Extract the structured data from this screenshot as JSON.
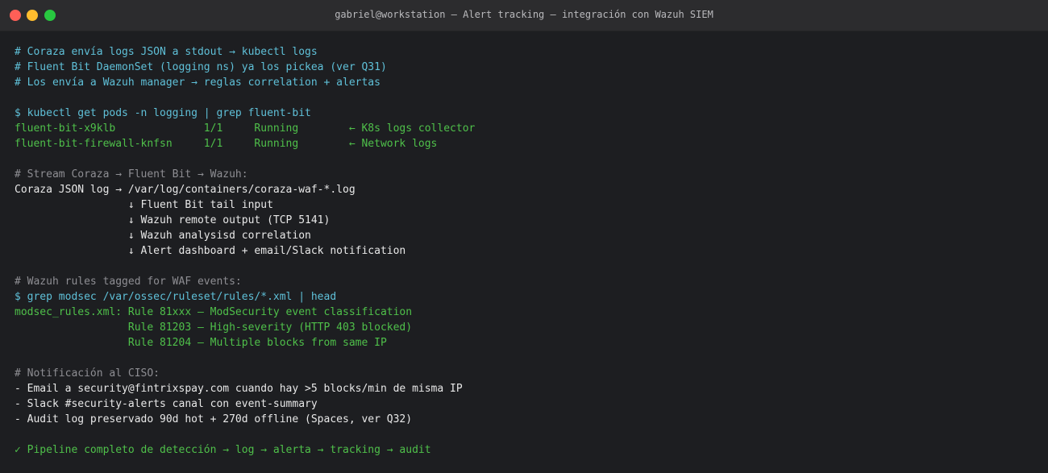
{
  "window": {
    "title": "gabriel@workstation — Alert tracking — integración con Wazuh SIEM"
  },
  "terminal": {
    "lines": [
      {
        "text": "# Coraza envía logs JSON a stdout → kubectl logs",
        "style": "c-comment-cyan"
      },
      {
        "text": "# Fluent Bit DaemonSet (logging ns) ya los pickea (ver Q31)",
        "style": "c-comment-cyan"
      },
      {
        "text": "# Los envía a Wazuh manager → reglas correlation + alertas",
        "style": "c-comment-cyan"
      },
      {
        "text": "",
        "style": "c-white"
      },
      {
        "text": "$ kubectl get pods -n logging | grep fluent-bit",
        "style": "c-cmd"
      },
      {
        "text": "fluent-bit-x9klb              1/1     Running        ← K8s logs collector",
        "style": "c-green"
      },
      {
        "text": "fluent-bit-firewall-knfsn     1/1     Running        ← Network logs",
        "style": "c-green"
      },
      {
        "text": "",
        "style": "c-white"
      },
      {
        "text": "# Stream Coraza → Fluent Bit → Wazuh:",
        "style": "c-gray"
      },
      {
        "text": "Coraza JSON log → /var/log/containers/coraza-waf-*.log",
        "style": "c-white"
      },
      {
        "text": "                  ↓ Fluent Bit tail input",
        "style": "c-white"
      },
      {
        "text": "                  ↓ Wazuh remote output (TCP 5141)",
        "style": "c-white"
      },
      {
        "text": "                  ↓ Wazuh analysisd correlation",
        "style": "c-white"
      },
      {
        "text": "                  ↓ Alert dashboard + email/Slack notification",
        "style": "c-white"
      },
      {
        "text": "",
        "style": "c-white"
      },
      {
        "text": "# Wazuh rules tagged for WAF events:",
        "style": "c-gray"
      },
      {
        "text": "$ grep modsec /var/ossec/ruleset/rules/*.xml | head",
        "style": "c-cmd"
      },
      {
        "text": "modsec_rules.xml: Rule 81xxx — ModSecurity event classification",
        "style": "c-green"
      },
      {
        "text": "                  Rule 81203 — High-severity (HTTP 403 blocked)",
        "style": "c-green"
      },
      {
        "text": "                  Rule 81204 — Multiple blocks from same IP",
        "style": "c-green"
      },
      {
        "text": "",
        "style": "c-white"
      },
      {
        "text": "# Notificación al CISO:",
        "style": "c-gray"
      },
      {
        "text": "- Email a security@fintrixspay.com cuando hay >5 blocks/min de misma IP",
        "style": "c-white"
      },
      {
        "text": "- Slack #security-alerts canal con event-summary",
        "style": "c-white"
      },
      {
        "text": "- Audit log preservado 90d hot + 270d offline (Spaces, ver Q32)",
        "style": "c-white"
      },
      {
        "text": "",
        "style": "c-white"
      },
      {
        "text": "✓ Pipeline completo de detección → log → alerta → tracking → audit",
        "style": "c-green"
      }
    ]
  }
}
